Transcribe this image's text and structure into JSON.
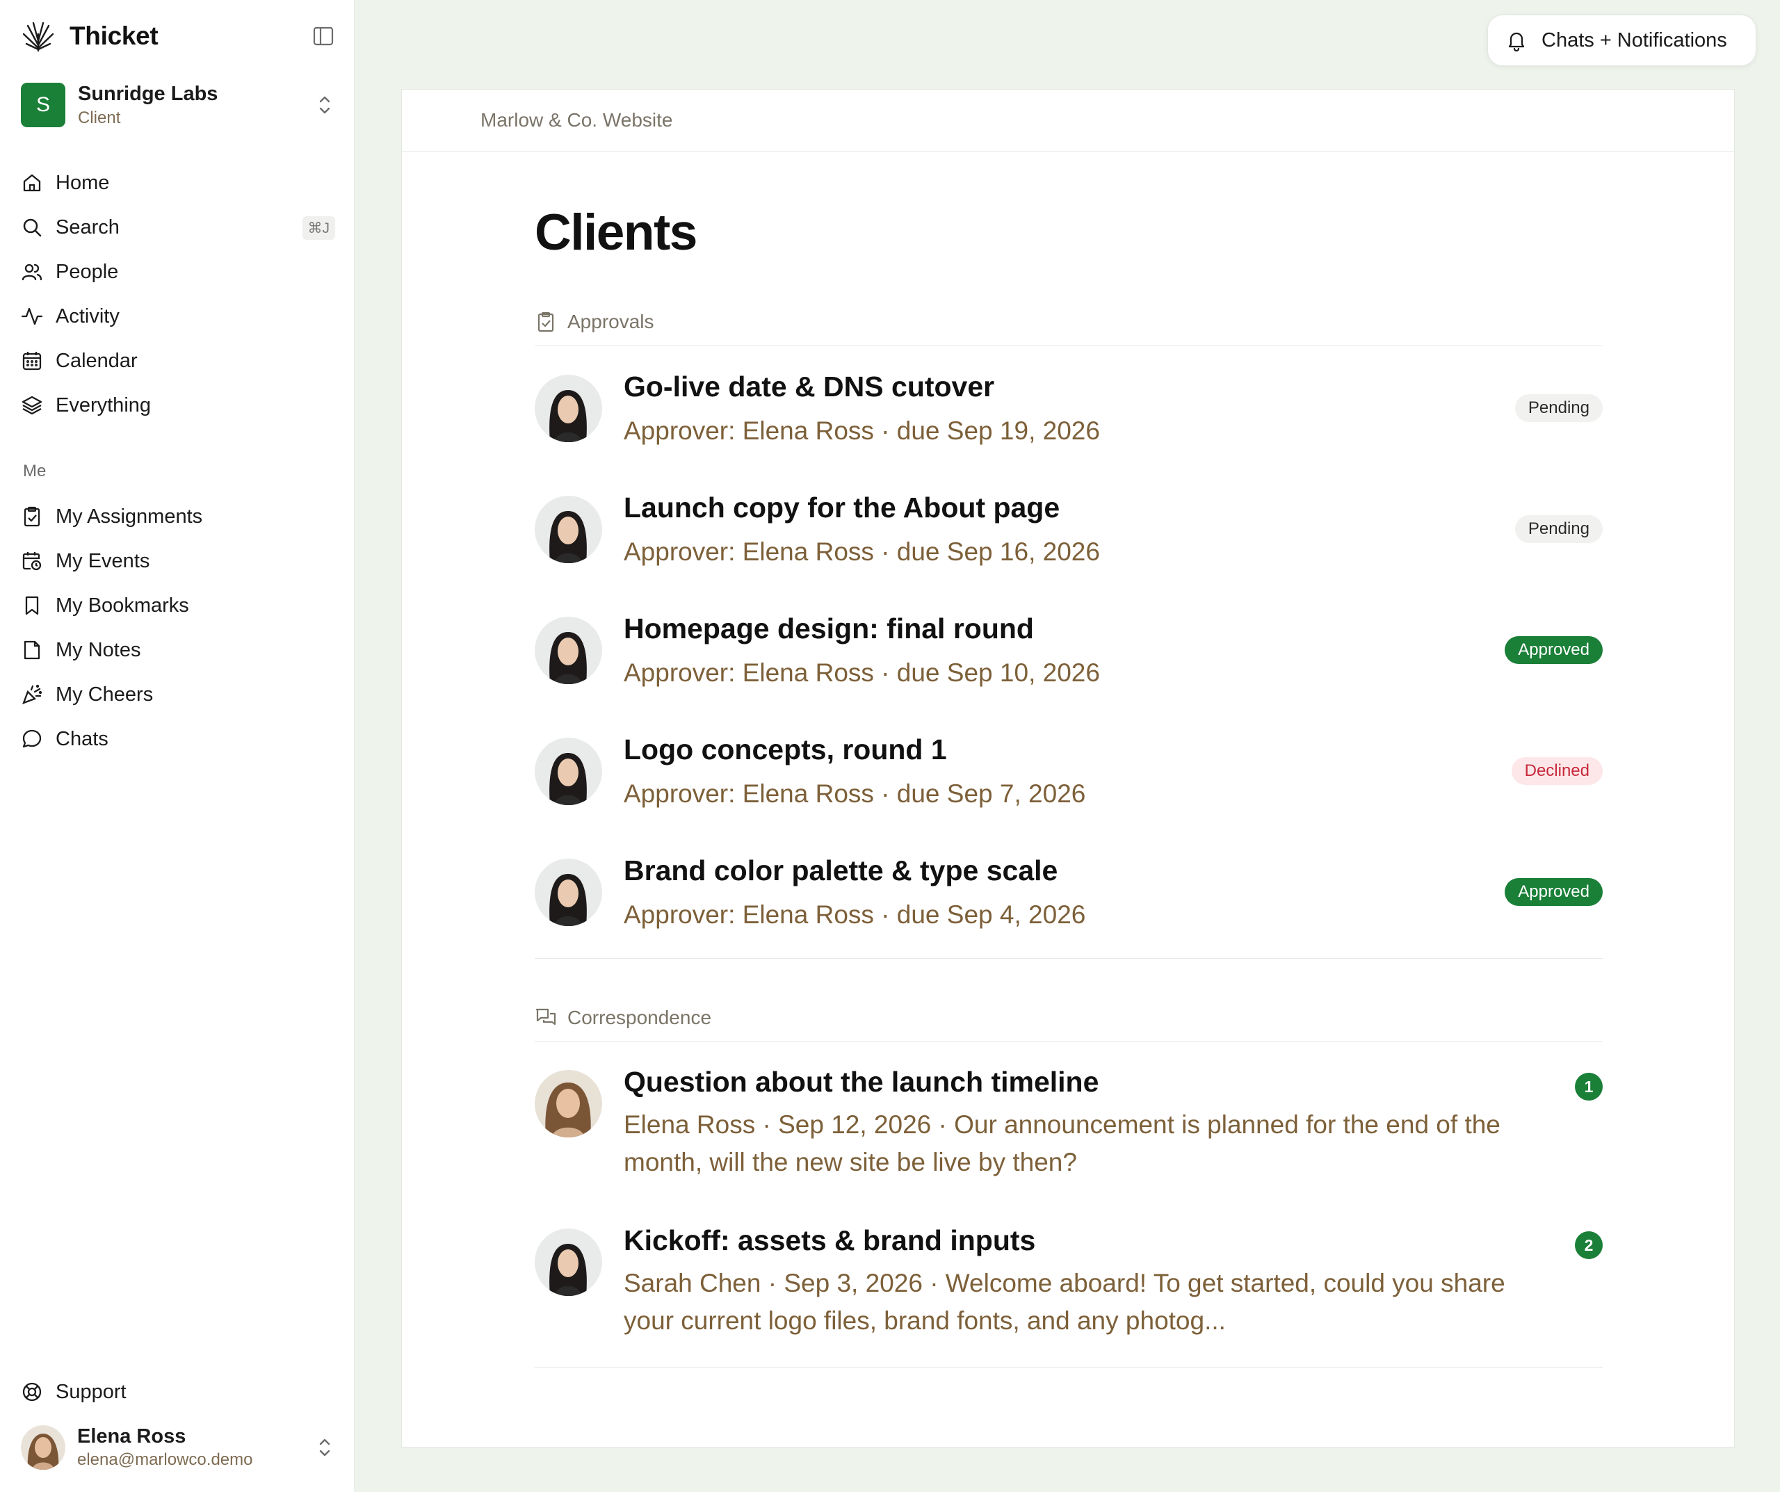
{
  "app": {
    "name": "Thicket",
    "accent_color": "#1a7f37"
  },
  "workspace": {
    "initial": "S",
    "name": "Sunridge Labs",
    "role": "Client"
  },
  "nav": {
    "primary": [
      {
        "label": "Home",
        "icon": "home-icon"
      },
      {
        "label": "Search",
        "icon": "search-icon",
        "shortcut": "⌘J"
      },
      {
        "label": "People",
        "icon": "people-icon"
      },
      {
        "label": "Activity",
        "icon": "activity-icon"
      },
      {
        "label": "Calendar",
        "icon": "calendar-icon"
      },
      {
        "label": "Everything",
        "icon": "layers-icon"
      }
    ],
    "me_label": "Me",
    "me": [
      {
        "label": "My Assignments",
        "icon": "clipboard-check-icon"
      },
      {
        "label": "My Events",
        "icon": "calendar-clock-icon"
      },
      {
        "label": "My Bookmarks",
        "icon": "bookmark-icon"
      },
      {
        "label": "My Notes",
        "icon": "note-icon"
      },
      {
        "label": "My Cheers",
        "icon": "party-popper-icon"
      },
      {
        "label": "Chats",
        "icon": "chat-bubble-icon"
      }
    ],
    "support": "Support"
  },
  "user": {
    "name": "Elena Ross",
    "email": "elena@marlowco.demo"
  },
  "topbar": {
    "notifications_label": "Chats + Notifications"
  },
  "main": {
    "breadcrumb": "Marlow & Co. Website",
    "title": "Clients",
    "approvals": {
      "heading": "Approvals",
      "items": [
        {
          "title": "Go-live date & DNS cutover",
          "subtitle": "Approver: Elena Ross · due Sep 19, 2026",
          "status": "Pending"
        },
        {
          "title": "Launch copy for the About page",
          "subtitle": "Approver: Elena Ross · due Sep 16, 2026",
          "status": "Pending"
        },
        {
          "title": "Homepage design: final round",
          "subtitle": "Approver: Elena Ross · due Sep 10, 2026",
          "status": "Approved"
        },
        {
          "title": "Logo concepts, round 1",
          "subtitle": "Approver: Elena Ross · due Sep 7, 2026",
          "status": "Declined"
        },
        {
          "title": "Brand color palette & type scale",
          "subtitle": "Approver: Elena Ross · due Sep 4, 2026",
          "status": "Approved"
        }
      ]
    },
    "correspondence": {
      "heading": "Correspondence",
      "items": [
        {
          "title": "Question about the launch timeline",
          "subtitle": "Elena Ross · Sep 12, 2026 · Our announcement is planned for the end of the month, will the new site be live by then?",
          "count": "1"
        },
        {
          "title": "Kickoff: assets & brand inputs",
          "subtitle": "Sarah Chen · Sep 3, 2026 · Welcome aboard! To get started, could you share your current logo files, brand fonts, and any photog...",
          "count": "2"
        }
      ]
    }
  }
}
